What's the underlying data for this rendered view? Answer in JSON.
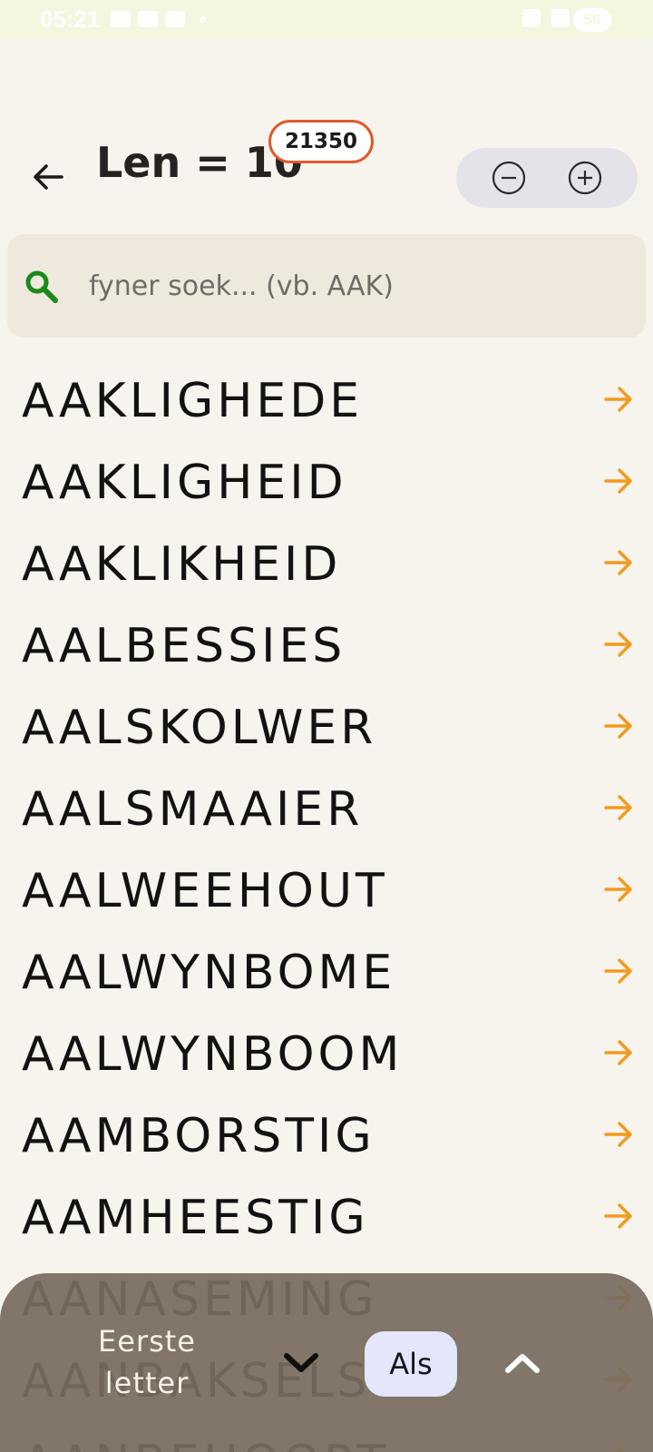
{
  "status_bar": {
    "time": "05:21",
    "battery": "56"
  },
  "header": {
    "title": "Len = 10",
    "count": "21350",
    "zoom_out_icon": "minus-circle-icon",
    "zoom_in_icon": "plus-circle-icon"
  },
  "search": {
    "placeholder": "fyner soek... (vb. AAK)",
    "value": ""
  },
  "words": [
    "AAKLIGHEDE",
    "AAKLIGHEID",
    "AAKLIKHEID",
    "AALBESSIES",
    "AALSKOLWER",
    "AALSMAAIER",
    "AALWEEHOUT",
    "AALWYNBOME",
    "AALWYNBOOM",
    "AAMBORSTIG",
    "AAMHEESTIG",
    "AANASEMING",
    "AANBAKSELS",
    "AANBEHOORT"
  ],
  "bottom_bar": {
    "first_letter_line1": "Eerste",
    "first_letter_line2": "letter",
    "selected_letter": "Als"
  },
  "colors": {
    "accent_orange": "#f29a1c",
    "badge_border": "#e05a2b",
    "search_icon": "#1a8a1a"
  }
}
